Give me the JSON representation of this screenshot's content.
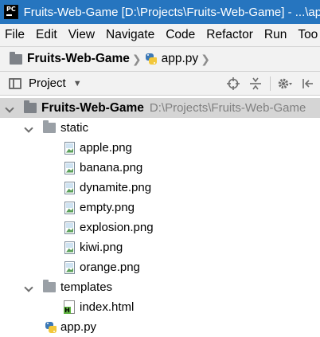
{
  "window": {
    "title": "Fruits-Web-Game [D:\\Projects\\Fruits-Web-Game] - ...\\app",
    "title_color": "#2675bf",
    "app_icon": "pycharm-icon"
  },
  "menu": {
    "items": [
      "File",
      "Edit",
      "View",
      "Navigate",
      "Code",
      "Refactor",
      "Run",
      "Too"
    ]
  },
  "navbar": {
    "project": "Fruits-Web-Game",
    "file": "app.py"
  },
  "toolwindow": {
    "title": "Project",
    "icons": [
      "locate-icon",
      "collapse-all-icon",
      "settings-icon",
      "hide-icon"
    ]
  },
  "tree": {
    "root": {
      "name": "Fruits-Web-Game",
      "path": "D:\\Projects\\Fruits-Web-Game"
    },
    "static_folder": "static",
    "static_files": [
      "apple.png",
      "banana.png",
      "dynamite.png",
      "empty.png",
      "explosion.png",
      "kiwi.png",
      "orange.png"
    ],
    "templates_folder": "templates",
    "templates_files": [
      "index.html"
    ],
    "root_files": [
      "app.py"
    ]
  },
  "colors": {
    "selection": "#d5d5d5",
    "chrome": "#f2f2f2",
    "path_gray": "#808080"
  }
}
